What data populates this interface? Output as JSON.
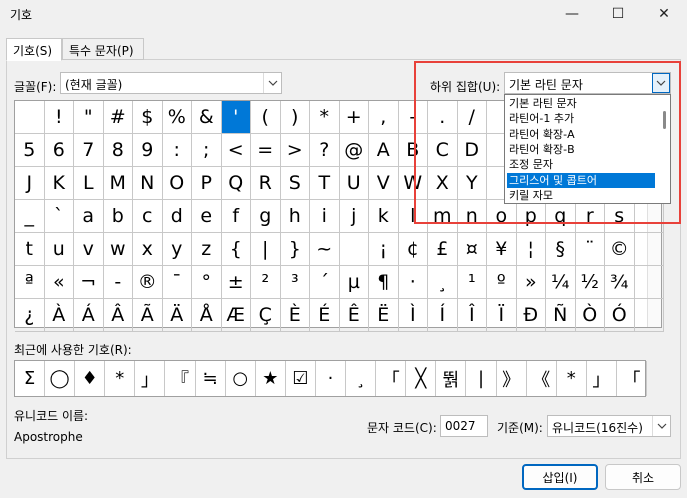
{
  "window": {
    "title": "기호",
    "minimize_icon": "—",
    "maximize_icon": "☐",
    "close_icon": "✕"
  },
  "tabs": [
    {
      "label": "기호(S)"
    },
    {
      "label": "특수 문자(P)"
    }
  ],
  "font": {
    "label": "글꼴(F):",
    "value": "(현재 글꼴)"
  },
  "subset": {
    "label": "하위 집합(U):",
    "value": "기본 라틴 문자",
    "options": [
      "기본 라틴 문자",
      "라틴어-1 추가",
      "라틴어 확장-A",
      "라틴어 확장-B",
      "조정 문자",
      "그리스어 및 콥트어",
      "키릴 자모"
    ],
    "highlighted_index": 5
  },
  "symbol_rows": [
    [
      "",
      "!",
      "\"",
      "#",
      "$",
      "%",
      "&",
      "'",
      "(",
      ")",
      "*",
      "+",
      ",",
      "-",
      ".",
      "/",
      "",
      "",
      "",
      "",
      "",
      ""
    ],
    [
      "5",
      "6",
      "7",
      "8",
      "9",
      ":",
      ";",
      "<",
      "=",
      ">",
      "?",
      "@",
      "A",
      "B",
      "C",
      "D",
      "",
      "",
      "",
      "",
      "",
      ""
    ],
    [
      "J",
      "K",
      "L",
      "M",
      "N",
      "O",
      "P",
      "Q",
      "R",
      "S",
      "T",
      "U",
      "V",
      "W",
      "X",
      "Y",
      "",
      "",
      "",
      "",
      "",
      ""
    ],
    [
      "_",
      "`",
      "a",
      "b",
      "c",
      "d",
      "e",
      "f",
      "g",
      "h",
      "i",
      "j",
      "k",
      "l",
      "m",
      "n",
      "o",
      "p",
      "q",
      "r",
      "s",
      ""
    ],
    [
      "t",
      "u",
      "v",
      "w",
      "x",
      "y",
      "z",
      "{",
      "|",
      "}",
      "~",
      "",
      "¡",
      "¢",
      "£",
      "¤",
      "¥",
      "¦",
      "§",
      "¨",
      "©",
      ""
    ],
    [
      "ª",
      "«",
      "¬",
      "-",
      "®",
      "¯",
      "°",
      "±",
      "²",
      "³",
      "´",
      "µ",
      "¶",
      "·",
      "¸",
      "¹",
      "º",
      "»",
      "¼",
      "½",
      "¾",
      ""
    ],
    [
      "¿",
      "À",
      "Á",
      "Â",
      "Ã",
      "Ä",
      "Å",
      "Æ",
      "Ç",
      "È",
      "É",
      "Ê",
      "Ë",
      "Ì",
      "Í",
      "Î",
      "Ï",
      "Ð",
      "Ñ",
      "Ò",
      "Ó",
      ""
    ]
  ],
  "selected_cell": {
    "row": 0,
    "col": 7
  },
  "recent": {
    "label": "최근에 사용한 기호(R):",
    "symbols": [
      "Σ",
      "◯",
      "♦",
      "*",
      "」",
      "『",
      "≒",
      "○",
      "★",
      "☑",
      "·",
      "¸",
      "「",
      "╳",
      "뛁",
      "|",
      "》",
      "《",
      "*",
      "」",
      "「"
    ]
  },
  "unicode_name": {
    "label": "유니코드 이름:",
    "value": "Apostrophe"
  },
  "char_code": {
    "label": "문자 코드(C):",
    "value": "0027"
  },
  "from": {
    "label": "기준(M):",
    "value": "유니코드(16진수)"
  },
  "buttons": {
    "insert": "삽입(I)",
    "cancel": "취소"
  }
}
